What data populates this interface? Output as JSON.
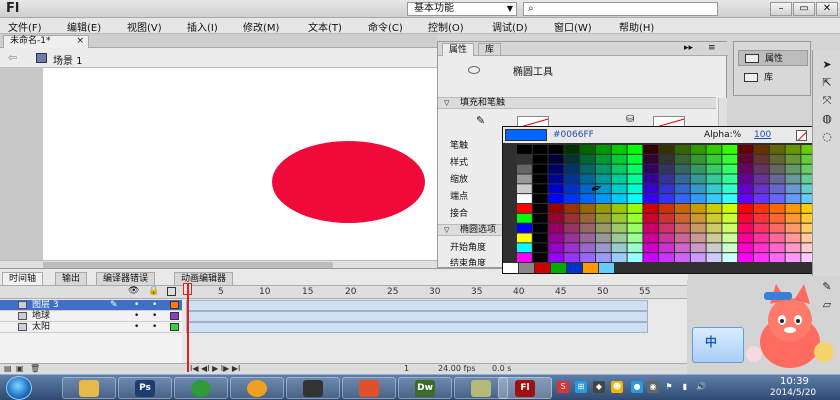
{
  "app": {
    "logo": "Fl",
    "workspace": "基本功能",
    "search_icon": "magnifier-icon",
    "window_buttons": [
      "minimize-icon",
      "restore-icon",
      "close-icon"
    ]
  },
  "menu": [
    "文件(F)",
    "编辑(E)",
    "视图(V)",
    "插入(I)",
    "修改(M)",
    "文本(T)",
    "命令(C)",
    "控制(O)",
    "调试(D)",
    "窗口(W)",
    "帮助(H)"
  ],
  "document": {
    "tab": "未命名-1*",
    "close": "×",
    "scene": "场景 1"
  },
  "stage": {
    "ball_color": "#f00a3a"
  },
  "timeline": {
    "tabs": [
      "时间轴",
      "输出",
      "编译器错误",
      "动画编辑器"
    ],
    "frame_numbers": [
      "5",
      "10",
      "15",
      "20",
      "25",
      "30",
      "35",
      "40",
      "45",
      "50",
      "55"
    ],
    "first_frame": "1",
    "layers": [
      {
        "name": "图层 3",
        "color": "#ff7a00",
        "selected": true
      },
      {
        "name": "地球",
        "color": "#8c3fc7",
        "selected": false
      },
      {
        "name": "太阳",
        "color": "#3fd03f",
        "selected": false
      }
    ],
    "status": {
      "frame": "1",
      "fps": "24.00 fps",
      "time": "0.0 s"
    }
  },
  "properties": {
    "tabs": [
      "属性",
      "库"
    ],
    "tool_name": "椭圆工具",
    "section_fill": "填充和笔触",
    "labels": [
      "笔触",
      "样式",
      "缩放",
      "端点",
      "接合"
    ],
    "section_oval": "椭圆选项",
    "oval_labels": [
      "开始角度",
      "结束角度"
    ]
  },
  "color_picker": {
    "current_color": "#0066ff",
    "hex": "#0066FF",
    "alpha_label": "Alpha:%",
    "alpha_value": "100"
  },
  "side_panel": {
    "items": [
      "属性",
      "库"
    ]
  },
  "ime": {
    "char": "中"
  },
  "taskbar": {
    "apps": [
      {
        "name": "explorer",
        "label": "",
        "color": "#e7b84a"
      },
      {
        "name": "photoshop",
        "label": "Ps",
        "color": "#1c3d6e"
      },
      {
        "name": "sync",
        "label": "",
        "color": "#2d9b3a"
      },
      {
        "name": "mascot-app",
        "label": "",
        "color": "#f0a020"
      },
      {
        "name": "video",
        "label": "",
        "color": "#333333"
      },
      {
        "name": "recorder",
        "label": "",
        "color": "#e0502a"
      },
      {
        "name": "dreamweaver",
        "label": "Dw",
        "color": "#3a6b28"
      },
      {
        "name": "notes",
        "label": "",
        "color": "#b5b878"
      },
      {
        "name": "flash",
        "label": "Fl",
        "color": "#9e1212"
      }
    ],
    "clock_time": "10:39",
    "clock_date": "2014/5/20"
  }
}
